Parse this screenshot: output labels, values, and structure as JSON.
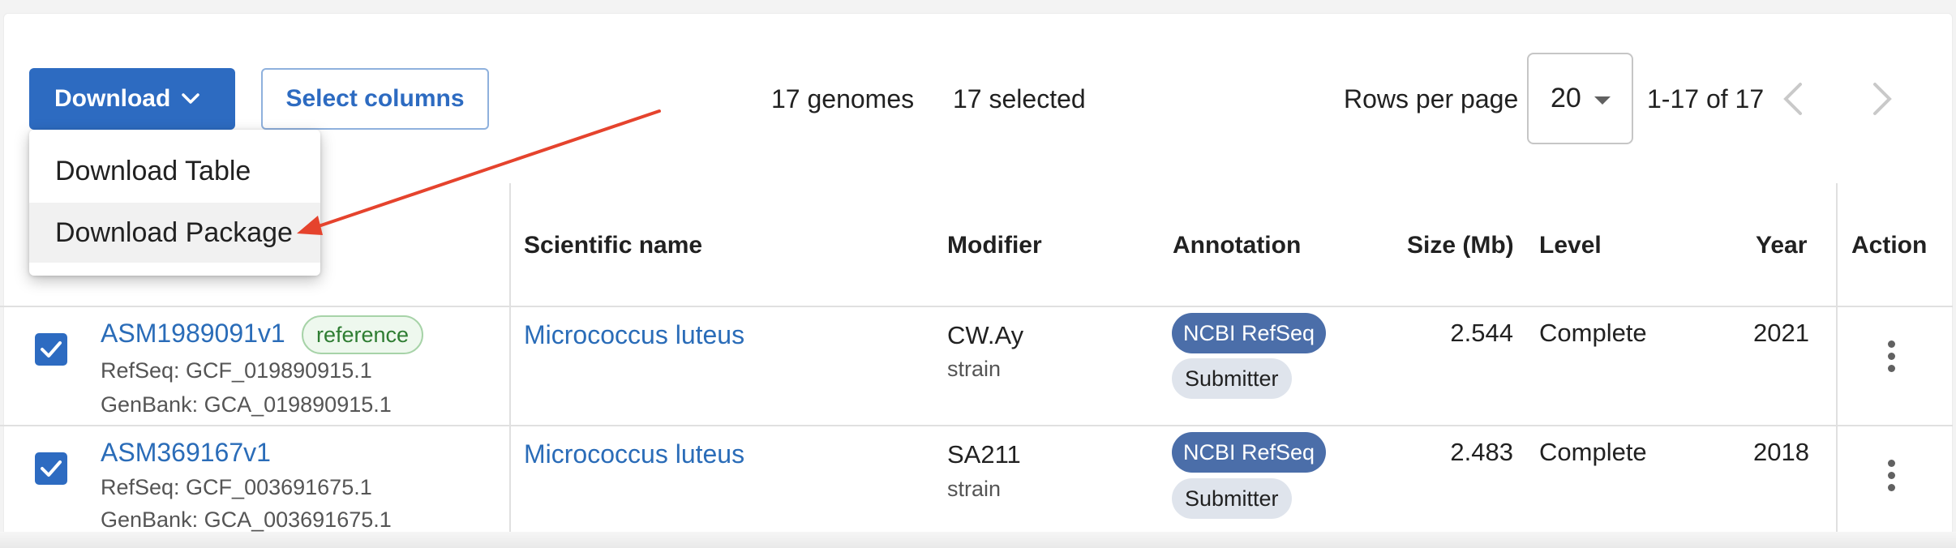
{
  "toolbar": {
    "download_label": "Download",
    "select_columns_label": "Select columns",
    "genome_count": "17 genomes",
    "selected_count": "17 selected",
    "rows_per_page_label": "Rows per page",
    "rows_per_page_value": "20",
    "range": "1-17 of 17"
  },
  "download_menu": {
    "items": [
      "Download Table",
      "Download Package"
    ],
    "highlighted": "Download Package"
  },
  "table": {
    "headers": {
      "scientific_name": "Scientific name",
      "modifier": "Modifier",
      "annotation": "Annotation",
      "size": "Size (Mb)",
      "level": "Level",
      "year": "Year",
      "action": "Action"
    },
    "rows": [
      {
        "checked": true,
        "assembly": "ASM1989091v1",
        "badge": "reference",
        "refseq": "RefSeq: GCF_019890915.1",
        "genbank": "GenBank: GCA_019890915.1",
        "scientific_name": "Micrococcus luteus",
        "modifier": "CW.Ay",
        "modifier_type": "strain",
        "annotations": [
          "NCBI RefSeq",
          "Submitter"
        ],
        "size": "2.544",
        "level": "Complete",
        "year": "2021"
      },
      {
        "checked": true,
        "assembly": "ASM369167v1",
        "refseq": "RefSeq: GCF_003691675.1",
        "genbank": "GenBank: GCA_003691675.1",
        "scientific_name": "Micrococcus luteus",
        "modifier": "SA211",
        "modifier_type": "strain",
        "annotations": [
          "NCBI RefSeq",
          "Submitter"
        ],
        "size": "2.483",
        "level": "Complete",
        "year": "2018"
      }
    ]
  },
  "annotation_arrow": {
    "color": "#e5432d"
  },
  "colors": {
    "primary": "#2d6bc1",
    "link": "#2a6cb8",
    "ncbi_chip": "#4b6ea9"
  }
}
